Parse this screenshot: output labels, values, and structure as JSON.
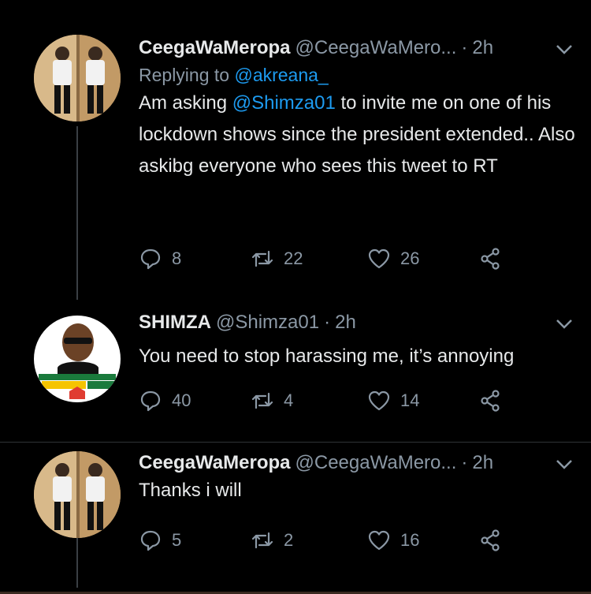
{
  "tweets": [
    {
      "name": "CeegaWaMeropa",
      "handle": "@CeegaWaMero...",
      "time": "2h",
      "reply_prefix": "Replying to",
      "reply_to": "@akreana_",
      "text_before": "Am asking",
      "mention": "@Shimza01",
      "text_after": "to invite me on one of his lockdown shows since the president extended.. Also askibg everyone who sees this tweet to RT",
      "replies": "8",
      "retweets": "22",
      "likes": "26"
    },
    {
      "name": "SHIMZA",
      "handle": "@Shimza01",
      "time": "2h",
      "text": "You need to stop harassing me, it’s annoying",
      "replies": "40",
      "retweets": "4",
      "likes": "14"
    },
    {
      "name": "CeegaWaMeropa",
      "handle": "@CeegaWaMero...",
      "time": "2h",
      "text": "Thanks i will",
      "replies": "5",
      "retweets": "2",
      "likes": "16"
    }
  ],
  "icons": {
    "reply": "reply-icon",
    "retweet": "retweet-icon",
    "like": "heart-icon",
    "share": "share-icon",
    "menu": "chevron-down-icon"
  },
  "colors": {
    "background": "#000000",
    "text": "#e7e9ea",
    "muted": "#8b98a5",
    "link": "#1d9bf0"
  }
}
